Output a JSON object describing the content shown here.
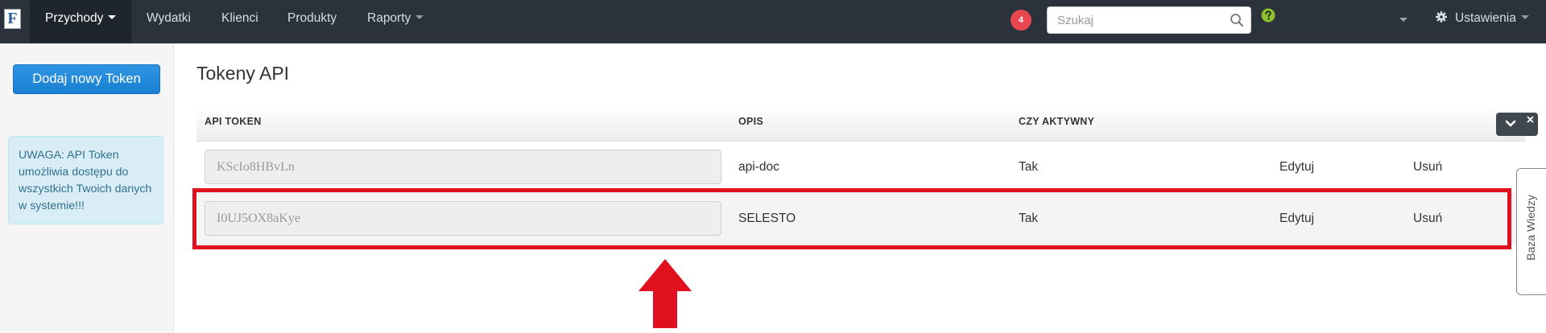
{
  "logo": {
    "letter": "F"
  },
  "nav": {
    "items": [
      {
        "label": "Przychody"
      },
      {
        "label": "Wydatki"
      },
      {
        "label": "Klienci"
      },
      {
        "label": "Produkty"
      },
      {
        "label": "Raporty"
      }
    ],
    "notifications_count": "4",
    "search_placeholder": "Szukaj",
    "settings_label": "Ustawienia"
  },
  "sidebar": {
    "add_token_label": "Dodaj nowy Token",
    "alert_text": "UWAGA: API Token umożliwia dostępu do wszystkich Twoich danych w systemie!!!"
  },
  "main": {
    "title": "Tokeny API",
    "columns": [
      "API TOKEN",
      "OPIS",
      "CZY AKTYWNY"
    ],
    "rows": [
      {
        "token": "KScIo8HBvLn",
        "description": "api-doc",
        "active": "Tak",
        "edit": "Edytuj",
        "delete": "Usuń"
      },
      {
        "token": "I0UJ5OX8aKye",
        "description": "SELESTO",
        "active": "Tak",
        "edit": "Edytuj",
        "delete": "Usuń"
      }
    ]
  },
  "knowledge_tab": {
    "label": "Baza Wiedzy"
  },
  "colors": {
    "navbar": "#2b323b",
    "primary_button": "#1a7fd0",
    "badge": "#e8474f",
    "highlight": "#e0101e"
  }
}
